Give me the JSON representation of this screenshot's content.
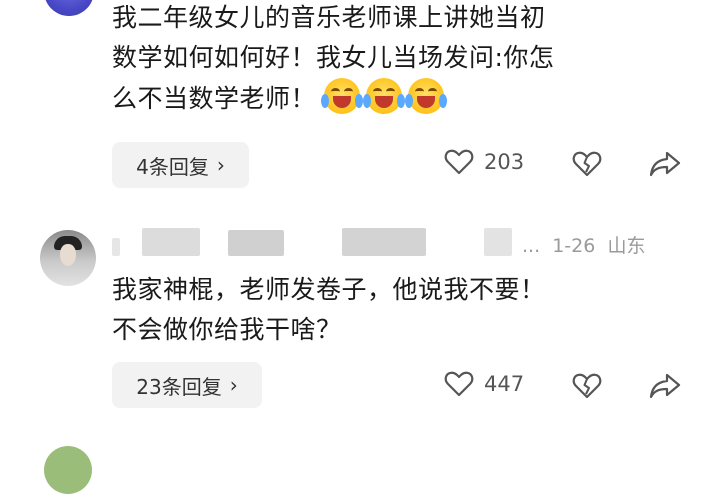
{
  "comments": [
    {
      "text_lines": [
        "我二年级女儿的音乐老师课上讲她当初",
        "数学如何如何好！我女儿当场发问:你怎",
        "么不当数学老师！"
      ],
      "emoji": "loudly-crying-laughing-face",
      "reply_label": "4条回复",
      "likes": "203"
    },
    {
      "date": "1-26",
      "location": "山东",
      "ellipsis": "...",
      "text_lines": [
        "我家神棍，老师发卷子，他说我不要！",
        "不会做你给我干啥？"
      ],
      "reply_label": "23条回复",
      "likes": "447"
    }
  ],
  "icons": {
    "reply_chevron": "chevron-right-icon",
    "like": "heart-outline-icon",
    "dislike": "broken-heart-icon",
    "share": "share-arrow-icon"
  }
}
